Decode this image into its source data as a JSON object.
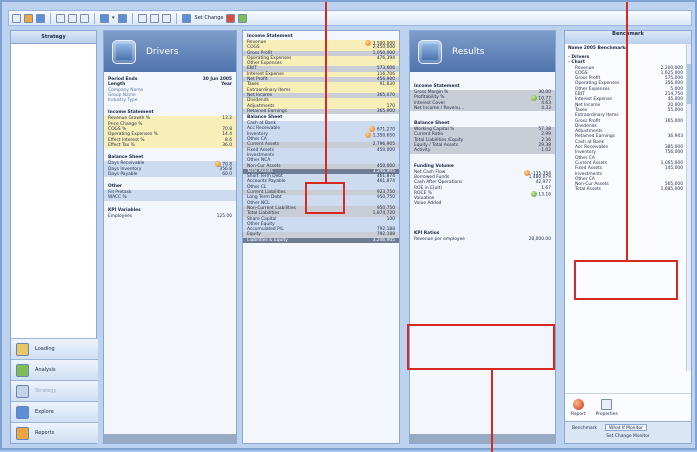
{
  "toolbar": {
    "set_change_label": "Set Change"
  },
  "sidebar": {
    "header": "Strategy",
    "nav": [
      {
        "label": "Loading",
        "icon": "folder-icon",
        "color": "#e8c766",
        "enabled": true
      },
      {
        "label": "Analysis",
        "icon": "chart-icon",
        "color": "#7fbd57",
        "enabled": true
      },
      {
        "label": "Strategy",
        "icon": "strategy-icon",
        "color": "#c6d3e6",
        "enabled": false
      },
      {
        "label": "Explore",
        "icon": "explore-icon",
        "color": "#5b8fd8",
        "enabled": true
      },
      {
        "label": "Reports",
        "icon": "reports-icon",
        "color": "#f0a544",
        "enabled": true
      }
    ]
  },
  "drivers": {
    "title": "Drivers",
    "info": [
      {
        "label": "Period Ends",
        "value": "30 Jun 2005",
        "style": "bold"
      },
      {
        "label": "Length",
        "value": "Year",
        "style": "bold"
      },
      {
        "label": "Company Name",
        "value": "",
        "style": "link"
      },
      {
        "label": "Group Name",
        "value": "",
        "style": "link"
      },
      {
        "label": "Industry Type",
        "value": "",
        "style": "link"
      }
    ],
    "income_title": "Income Statement",
    "income": [
      {
        "label": "Revenue Growth %",
        "value": "13.2"
      },
      {
        "label": "Price Change %",
        "value": ""
      },
      {
        "label": "COGS %",
        "value": "70.8"
      },
      {
        "label": "Operating Expenses %",
        "value": "14.4"
      },
      {
        "label": "Effect Interest %",
        "value": "8.6"
      },
      {
        "label": "Effect Tax %",
        "value": "36.0"
      }
    ],
    "balance_title": "Balance Sheet",
    "balance": [
      {
        "label": "Days Receivable",
        "value": "70.8",
        "dot": "orange"
      },
      {
        "label": "Days Inventory",
        "value": "356.8",
        "dot": ""
      },
      {
        "label": "Days Payable",
        "value": "60.0",
        "dot": ""
      }
    ],
    "other_title": "Other",
    "other": [
      {
        "label": "Fill Pretask",
        "value": ""
      },
      {
        "label": "WACC %",
        "value": ""
      }
    ],
    "kpi_title": "KPI Variables",
    "kpi": [
      {
        "label": "Employees",
        "value": "125.00"
      }
    ]
  },
  "statement": {
    "income_title": "Income Statement",
    "income": [
      {
        "label": "Revenue",
        "value": "3,500,000",
        "band": "yellow",
        "dot": "orange"
      },
      {
        "label": "COGS",
        "value": "2,450,000",
        "band": "yellow",
        "dot": ""
      },
      {
        "label": "Gross Profit",
        "value": "1,050,000",
        "band": "gray",
        "dot": ""
      },
      {
        "label": "Operating Expenses",
        "value": "476,394",
        "band": "yellow",
        "dot": ""
      },
      {
        "label": "Other Expenses",
        "value": "",
        "band": "yellow",
        "dot": ""
      },
      {
        "label": "EBIT",
        "value": "573,606",
        "band": "gray",
        "dot": ""
      },
      {
        "label": "Interest Expense",
        "value": "116,706",
        "band": "yellow",
        "dot": ""
      },
      {
        "label": "Net Profit",
        "value": "456,900",
        "band": "gray",
        "dot": ""
      },
      {
        "label": "Taxes",
        "value": "91,830",
        "band": "yellow",
        "dot": ""
      },
      {
        "label": "Extraordinary Items",
        "value": "",
        "band": "yellow",
        "dot": ""
      },
      {
        "label": "Net Income",
        "value": "365,070",
        "band": "gray",
        "dot": ""
      },
      {
        "label": "Dividends",
        "value": "",
        "band": "yellow",
        "dot": ""
      },
      {
        "label": "Adjustments",
        "value": "170",
        "band": "yellow",
        "dot": ""
      },
      {
        "label": "Retained Earnings",
        "value": "365,900",
        "band": "gray",
        "dot": ""
      }
    ],
    "balance_title": "Balance Sheet",
    "balance": [
      {
        "label": "Cash at Bank",
        "value": "",
        "band": "blue",
        "dot": ""
      },
      {
        "label": "Acc Receivable",
        "value": "671,270",
        "band": "blue",
        "dot": "orange"
      },
      {
        "label": "Inventory",
        "value": "1,350,650",
        "band": "blue",
        "dot": "orange"
      },
      {
        "label": "Other CA",
        "value": "",
        "band": "blue",
        "dot": ""
      },
      {
        "label": "Current Assets",
        "value": "2,796,905",
        "band": "gray",
        "dot": ""
      },
      {
        "label": "Fixed Assets",
        "value": "450,000",
        "band": "blue",
        "dot": ""
      },
      {
        "label": "Investments",
        "value": "",
        "band": "blue",
        "dot": ""
      },
      {
        "label": "Other NCA",
        "value": "",
        "band": "blue",
        "dot": ""
      },
      {
        "label": "Non-Cur Assets",
        "value": "450,000",
        "band": "gray",
        "dot": ""
      },
      {
        "label": "Total Assets",
        "value": "3,246,905",
        "band": "dark",
        "dot": ""
      },
      {
        "label": "Short Term Debt",
        "value": "461,874",
        "band": "blue",
        "dot": ""
      },
      {
        "label": "Accounts Payable",
        "value": "461,874",
        "band": "blue",
        "dot": ""
      },
      {
        "label": "Other CL",
        "value": "",
        "band": "blue",
        "dot": ""
      },
      {
        "label": "Current Liabilities",
        "value": "923,750",
        "band": "gray",
        "dot": ""
      },
      {
        "label": "Long Term Debt",
        "value": "950,750",
        "band": "blue",
        "dot": ""
      },
      {
        "label": "Other NCL",
        "value": "",
        "band": "blue",
        "dot": ""
      },
      {
        "label": "Non-Current Liabilities",
        "value": "950,750",
        "band": "gray",
        "dot": ""
      },
      {
        "label": "Total Liabilities",
        "value": "1,874,720",
        "band": "gray",
        "dot": ""
      },
      {
        "label": "Share Capital",
        "value": "100",
        "band": "blue",
        "dot": ""
      },
      {
        "label": "Other Equity",
        "value": "",
        "band": "blue",
        "dot": ""
      },
      {
        "label": "Accumulated P/L",
        "value": "792,188",
        "band": "blue",
        "dot": ""
      },
      {
        "label": "Equity",
        "value": "792,188",
        "band": "gray",
        "dot": ""
      },
      {
        "label": "Liabilities & Equity",
        "value": "3,246,905",
        "band": "dark",
        "dot": ""
      }
    ]
  },
  "results": {
    "title": "Results",
    "income_title": "Income Statement",
    "income": [
      {
        "label": "Gross Margin %",
        "value": "30.00",
        "band": "gray",
        "dot": ""
      },
      {
        "label": "Profitability %",
        "value": "10.77",
        "band": "gray",
        "dot": "green"
      },
      {
        "label": "Interest Cover",
        "value": "4.63",
        "band": "gray",
        "dot": ""
      },
      {
        "label": "Net Income / Revenu...",
        "value": "4.33",
        "band": "gray",
        "dot": ""
      }
    ],
    "balance_title": "Balance Sheet",
    "balance": [
      {
        "label": "Working Capital %",
        "value": "57.38",
        "band": "gray",
        "dot": ""
      },
      {
        "label": "Current Ratio",
        "value": "2.99",
        "band": "gray",
        "dot": ""
      },
      {
        "label": "Total Liabilities /Equity",
        "value": "2.36",
        "band": "gray",
        "dot": ""
      },
      {
        "label": "Equity / Total Assets",
        "value": "29.38",
        "band": "gray",
        "dot": ""
      },
      {
        "label": "Activity",
        "value": "1.02",
        "band": "gray",
        "dot": ""
      }
    ],
    "funding_title": "Funding Volume",
    "funding": [
      {
        "label": "Net Cash Flow",
        "value": "-135,354",
        "band": "",
        "dot": "orange"
      },
      {
        "label": "Borrowed Funds",
        "value": "1,480,079",
        "band": "",
        "dot": ""
      },
      {
        "label": "Cash After Operations",
        "value": "42,977",
        "band": "",
        "dot": ""
      },
      {
        "label": "ROE in E(ult)",
        "value": "1.67",
        "band": "",
        "dot": ""
      },
      {
        "label": "ROCE %",
        "value": "13.16",
        "band": "",
        "dot": "green"
      },
      {
        "label": "Valuation",
        "value": "",
        "band": "",
        "dot": ""
      },
      {
        "label": "Value Added",
        "value": "",
        "band": "",
        "dot": ""
      }
    ],
    "kpi_title": "KPI Ratios",
    "kpi": [
      {
        "label": "Revenue per employee",
        "value": "28,000.00"
      }
    ]
  },
  "benchmark": {
    "title": "Benchmark",
    "subtitle": "Name 2005 Benchmarks",
    "tree": [
      {
        "type": "node",
        "label": "- Drivers",
        "value": ""
      },
      {
        "type": "node",
        "label": "- Chart",
        "value": ""
      },
      {
        "type": "leaf",
        "label": "Revenue",
        "value": "2,200,000"
      },
      {
        "type": "leaf",
        "label": "COGS",
        "value": "1,625,000"
      },
      {
        "type": "leaf",
        "label": "Gross Profit",
        "value": "575,000"
      },
      {
        "type": "leaf",
        "label": "Operating Expenses",
        "value": "356,000"
      },
      {
        "type": "leaf",
        "label": "Other Expenses",
        "value": "5,000"
      },
      {
        "type": "leaf",
        "label": "EBIT",
        "value": "214,750"
      },
      {
        "type": "leaf",
        "label": "Interest Expense",
        "value": "45,000"
      },
      {
        "type": "leaf",
        "label": "Net Income",
        "value": "20,000"
      },
      {
        "type": "leaf",
        "label": "Taxes",
        "value": "55,000"
      },
      {
        "type": "leaf",
        "label": "Extraordinary Items",
        "value": ""
      },
      {
        "type": "leaf",
        "label": "Gross Profit",
        "value": "365,000"
      },
      {
        "type": "leaf",
        "label": "Dividends",
        "value": ""
      },
      {
        "type": "leaf",
        "label": "Adjustments",
        "value": ""
      },
      {
        "type": "leaf",
        "label": "Retained Earnings",
        "value": "36,943"
      },
      {
        "type": "leaf",
        "label": "Cash at Bank",
        "value": ""
      },
      {
        "type": "leaf",
        "label": "Acc Receivable",
        "value": "385,000"
      },
      {
        "type": "leaf",
        "label": "Inventory",
        "value": "756,000"
      },
      {
        "type": "leaf",
        "label": "Other CA",
        "value": ""
      },
      {
        "type": "leaf",
        "label": "Current Assets",
        "value": "1,065,000"
      },
      {
        "type": "leaf",
        "label": "Fixed Assets",
        "value": "145,000"
      },
      {
        "type": "leaf",
        "label": "Investments",
        "value": ""
      },
      {
        "type": "leaf",
        "label": "Other CA",
        "value": ""
      },
      {
        "type": "leaf",
        "label": "Non-Cur Assets",
        "value": "565,000"
      },
      {
        "type": "leaf",
        "label": "Total Assets",
        "value": "1,685,000"
      }
    ],
    "actions": [
      {
        "label": "Report",
        "icon": "report-icon"
      },
      {
        "label": "Properties",
        "icon": "properties-icon"
      }
    ],
    "tabs": [
      "Benchmark",
      "What If Monitor"
    ],
    "footer": "Set Change Monitor"
  },
  "colors": {
    "callout": "#d42a22",
    "income_band": "#f8efb8",
    "balance_band": "#cddbf0",
    "subtotal_band": "#c9ced6"
  }
}
